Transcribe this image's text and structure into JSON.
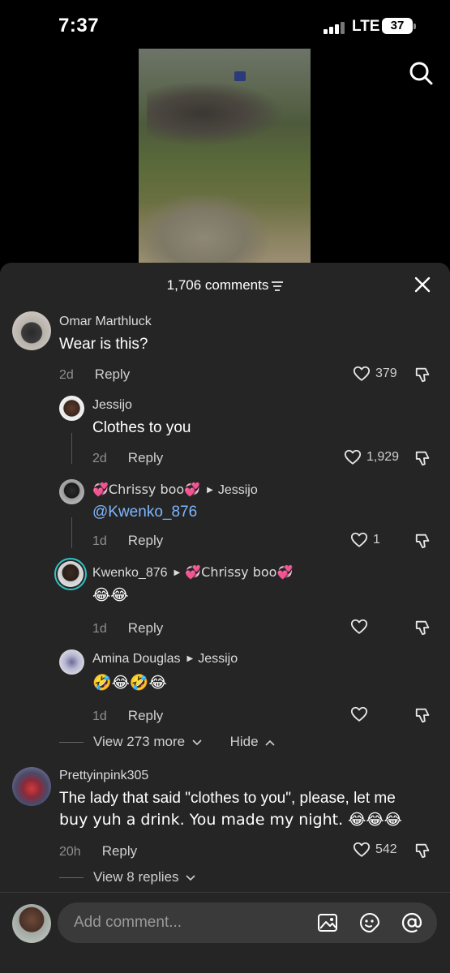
{
  "status_bar": {
    "time": "7:37",
    "network": "LTE",
    "battery": "37"
  },
  "sheet": {
    "comment_count": "1,706 comments"
  },
  "comments": [
    {
      "user": "Omar Marthluck",
      "text": "Wear is this?",
      "time": "2d",
      "reply": "Reply",
      "likes": "379"
    },
    {
      "user": "Jessijo",
      "text": "Clothes to you",
      "time": "2d",
      "reply": "Reply",
      "likes": "1,929"
    },
    {
      "user": "💞Chrissy boo💞",
      "reply_to": "Jessijo",
      "text": "@Kwenko_876",
      "time": "1d",
      "reply": "Reply",
      "likes": "1"
    },
    {
      "user": "Kwenko_876",
      "reply_to": "💞Chrissy boo💞",
      "text": "😂😂",
      "time": "1d",
      "reply": "Reply",
      "likes": ""
    },
    {
      "user": "Amina Douglas",
      "reply_to": "Jessijo",
      "text": "🤣😂🤣😂",
      "time": "1d",
      "reply": "Reply",
      "likes": ""
    },
    {
      "user": "Prettyinpink305",
      "text_line1": "The lady that said \"clothes to you\", please, let me",
      "text_line2": "buy yuh a drink. You made my night. 😂😂😂",
      "time": "20h",
      "reply": "Reply",
      "likes": "542"
    }
  ],
  "thread_controls": {
    "view_more": "View 273 more",
    "hide": "Hide"
  },
  "view_replies": "View 8 replies",
  "footer": {
    "placeholder": "Add comment..."
  },
  "icons": [
    "search-icon",
    "filter-icon",
    "close-icon",
    "heart-icon",
    "dislike-icon",
    "image-icon",
    "emoji-icon",
    "at-icon"
  ]
}
